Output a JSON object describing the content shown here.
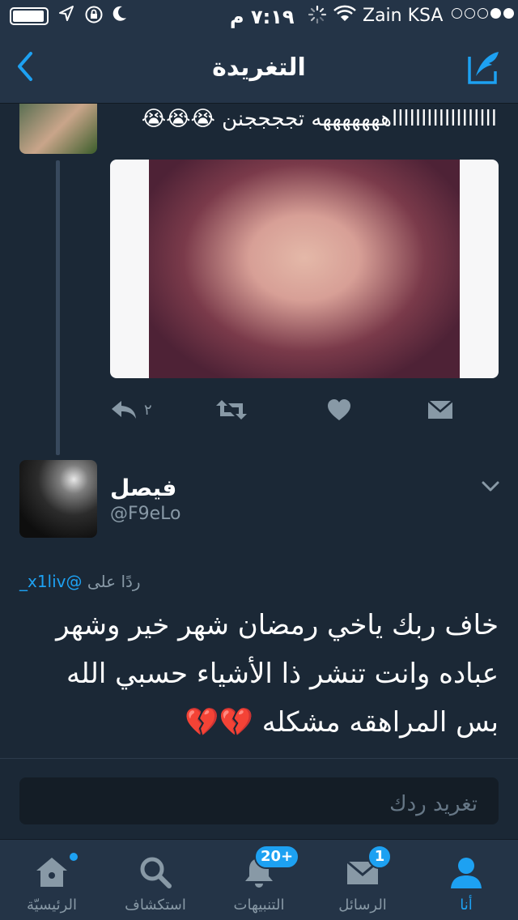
{
  "status_bar": {
    "time": "٧:١٩ م",
    "carrier": "Zain KSA",
    "icons": [
      "battery-icon",
      "location-icon",
      "rotation-lock-icon",
      "moon-icon",
      "loading-spinner-icon",
      "wifi-icon",
      "signal-dots-icon"
    ]
  },
  "nav": {
    "title": "التغريدة",
    "back_icon": "chevron-left-icon",
    "compose_icon": "compose-tweet-icon"
  },
  "media_tweet": {
    "text": "ااااااااااااااااااهههههههه تججججنن 😭😭😭",
    "reply_count": "٢",
    "actions": [
      "reply-icon",
      "retweet-icon",
      "like-icon",
      "direct-message-icon"
    ]
  },
  "main_tweet": {
    "author_name": "فيصل",
    "author_handle": "@F9eLo",
    "reply_to_prefix": "ردًا على",
    "reply_to_handle": "@x1liv_",
    "text": "خاف ربك ياخي رمضان شهر خير وشهر عباده وانت تنشر ذا الأشياء حسبي الله بس المراهقه مشكله 💔💔"
  },
  "composer": {
    "placeholder": "تغريد ردك"
  },
  "tabbar": {
    "tabs": [
      {
        "label": "الرئيسيّة",
        "icon": "home-icon",
        "badge": ""
      },
      {
        "label": "استكشاف",
        "icon": "search-icon",
        "badge": ""
      },
      {
        "label": "التنبيهات",
        "icon": "notifications-bell-icon",
        "badge": "20+"
      },
      {
        "label": "الرسائل",
        "icon": "messages-envelope-icon",
        "badge": "1"
      },
      {
        "label": "أنا",
        "icon": "profile-person-icon",
        "badge": ""
      }
    ]
  },
  "colors": {
    "accent": "#1da1f2",
    "background": "#1b2836",
    "bar": "#243447",
    "secondary_text": "#8899a6"
  }
}
